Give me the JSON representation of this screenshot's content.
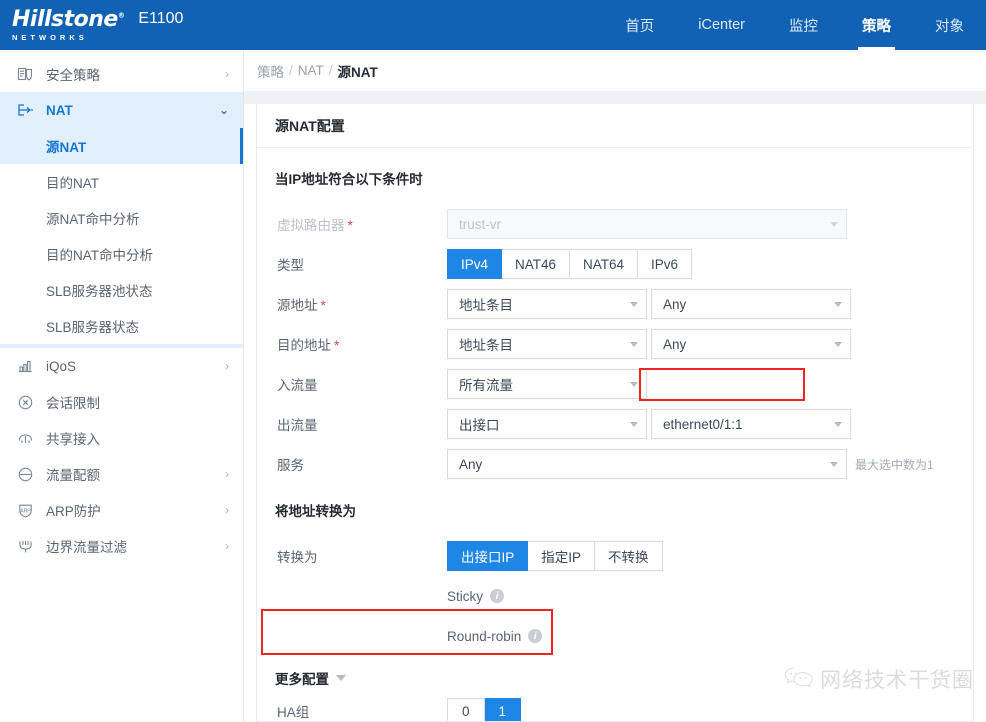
{
  "header": {
    "brand_name": "Hillstone",
    "brand_trademark": "®",
    "brand_sub": "NETWORKS",
    "model": "E1100",
    "nav": [
      {
        "label": "首页",
        "active": false
      },
      {
        "label": "iCenter",
        "active": false
      },
      {
        "label": "监控",
        "active": false
      },
      {
        "label": "策略",
        "active": true
      },
      {
        "label": "对象",
        "active": false
      }
    ],
    "accent_color": "#1161b4"
  },
  "sidebar": {
    "items": [
      {
        "label": "安全策略",
        "icon": "shield-policy-icon",
        "chevron": "›",
        "state": "collapsed"
      },
      {
        "label": "NAT",
        "icon": "nat-arrow-icon",
        "chevron": "⌄",
        "state": "expanded"
      }
    ],
    "nat_children": [
      {
        "label": "源NAT",
        "active": true
      },
      {
        "label": "目的NAT",
        "active": false
      },
      {
        "label": "源NAT命中分析",
        "active": false
      },
      {
        "label": "目的NAT命中分析",
        "active": false
      },
      {
        "label": "SLB服务器池状态",
        "active": false
      },
      {
        "label": "SLB服务器状态",
        "active": false
      }
    ],
    "items_after": [
      {
        "label": "iQoS",
        "icon": "bar-chart-icon",
        "chevron": "›"
      },
      {
        "label": "会话限制",
        "icon": "session-limit-icon",
        "chevron": ""
      },
      {
        "label": "共享接入",
        "icon": "share-access-icon",
        "chevron": ""
      },
      {
        "label": "流量配额",
        "icon": "traffic-quota-icon",
        "chevron": "›"
      },
      {
        "label": "ARP防护",
        "icon": "arp-shield-icon",
        "chevron": "›"
      },
      {
        "label": "边界流量过滤",
        "icon": "border-filter-icon",
        "chevron": "›"
      }
    ],
    "active_bg": "#e2effc",
    "active_color": "#1577d2"
  },
  "breadcrumb": {
    "items": [
      "策略",
      "NAT",
      "源NAT"
    ],
    "separator": "/"
  },
  "card": {
    "title": "源NAT配置",
    "section1_title": "当IP地址符合以下条件时",
    "section2_title": "将地址转换为",
    "more_config_label": "更多配置"
  },
  "form": {
    "vrouter": {
      "label": "虚拟路由器",
      "required": true,
      "value": "trust-vr",
      "disabled": true
    },
    "type": {
      "label": "类型",
      "options": [
        "IPv4",
        "NAT46",
        "NAT64",
        "IPv6"
      ],
      "selected": "IPv4"
    },
    "src_addr": {
      "label": "源地址",
      "required": true,
      "value1": "地址条目",
      "value2": "Any"
    },
    "dst_addr": {
      "label": "目的地址",
      "required": true,
      "value1": "地址条目",
      "value2": "Any"
    },
    "ingress": {
      "label": "入流量",
      "value1": "所有流量"
    },
    "egress": {
      "label": "出流量",
      "value1": "出接口",
      "value2": "ethernet0/1:1",
      "highlighted": true
    },
    "service": {
      "label": "服务",
      "value": "Any",
      "hint": "最大选中数为1"
    },
    "translate_to": {
      "label": "转换为",
      "options": [
        "出接口IP",
        "指定IP",
        "不转换"
      ],
      "selected": "出接口IP"
    },
    "sticky": {
      "label": "Sticky",
      "info": "i",
      "on": false
    },
    "round_robin": {
      "label": "Round-robin",
      "info": "i",
      "on": false
    },
    "ha_group": {
      "label": "HA组",
      "options": [
        "0",
        "1"
      ],
      "selected": "1",
      "highlighted": true
    }
  },
  "watermark": {
    "text": "网络技术干货圈",
    "icon": "wechat-icon"
  },
  "colors": {
    "header_blue": "#1161b4",
    "active_blue": "#1e87e5",
    "annotation_red": "#f42121",
    "required_red": "#e0404a"
  }
}
